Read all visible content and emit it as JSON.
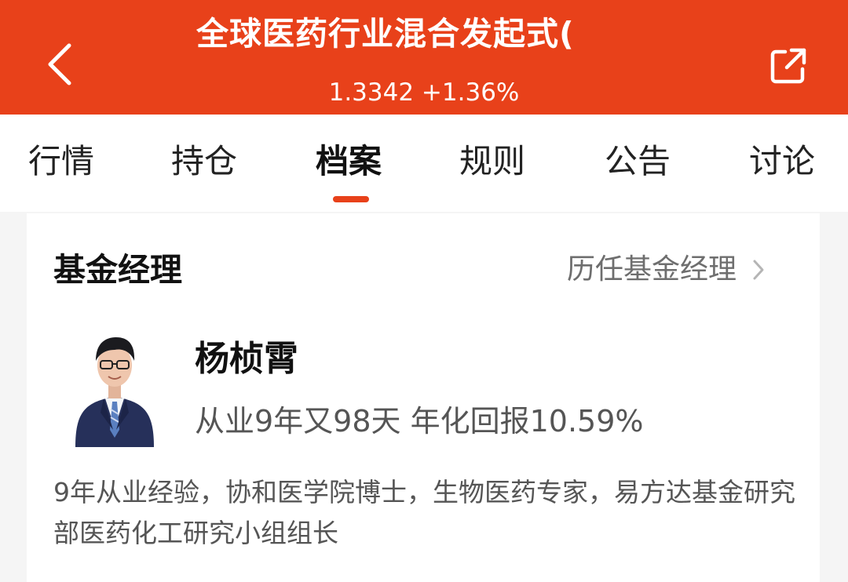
{
  "header": {
    "title": "全球医药行业混合发起式(",
    "subtitle": "1.3342 +1.36%",
    "back_icon": "chevron-left-icon",
    "share_icon": "share-external-icon",
    "background_color": "#e8411a"
  },
  "tabs": [
    {
      "label": "行情",
      "active": false
    },
    {
      "label": "持仓",
      "active": false
    },
    {
      "label": "档案",
      "active": true
    },
    {
      "label": "规则",
      "active": false
    },
    {
      "label": "公告",
      "active": false
    },
    {
      "label": "讨论",
      "active": false
    }
  ],
  "manager_section": {
    "title": "基金经理",
    "history_link": "历任基金经理",
    "history_icon": "chevron-right-icon",
    "manager": {
      "name": "杨桢霄",
      "stats": "从业9年又98天 年化回报10.59%",
      "description": "9年从业经验，协和医学院博士，生物医药专家，易方达基金研究部医药化工研究小组组长"
    }
  },
  "colors": {
    "accent": "#e8411a",
    "text_primary": "#111111",
    "text_secondary": "#555555"
  }
}
